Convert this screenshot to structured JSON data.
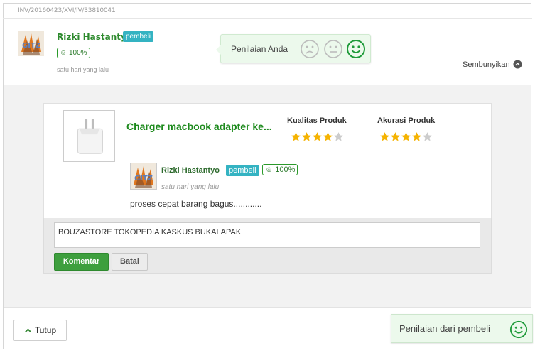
{
  "invoice": "INV/20160423/XVI/IV/33810041",
  "buyer": {
    "name": "Rizki Hastantyo",
    "badge": "pembeli",
    "reputation": "100%",
    "time": "satu hari yang lalu"
  },
  "rating_prompt": {
    "label": "Penilaian Anda",
    "faces": [
      "sad-face-icon",
      "neutral-face-icon",
      "happy-face-icon"
    ],
    "selected": "happy"
  },
  "hide_label": "Sembunyikan",
  "product": {
    "name": "Charger macbook adapter ke...",
    "quality_label": "Kualitas Produk",
    "quality_rating": 4,
    "accuracy_label": "Akurasi Produk",
    "accuracy_rating": 4,
    "max_rating": 5
  },
  "review": {
    "name": "Rizki Hastantyo",
    "badge": "pembeli",
    "reputation": "100%",
    "time": "satu hari yang lalu",
    "text": "proses cepat barang bagus............"
  },
  "comment": {
    "value": "BOUZASTORE TOKOPEDIA KASKUS BUKALAPAK",
    "submit_label": "Komentar",
    "cancel_label": "Batal"
  },
  "close_label": "Tutup",
  "buyer_rating_label": "Penilaian dari pembeli",
  "colors": {
    "accent_green": "#3e9f3e",
    "badge_teal": "#34b3c2",
    "star_gold": "#f5b301",
    "star_empty": "#cccccc"
  }
}
